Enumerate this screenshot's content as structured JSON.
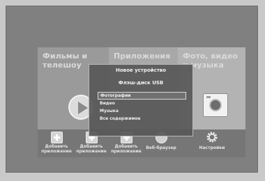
{
  "tiles": [
    {
      "title": "Фильмы и телешоу",
      "icon": "play-icon"
    },
    {
      "title": "Приложения",
      "icon": "apps-icon"
    },
    {
      "title": "Фото, видео и музыка",
      "icon": "camera-icon"
    }
  ],
  "bar": {
    "add1": "Добавить приложение",
    "add2": "Добавить приложение",
    "add3": "Добавить приложение",
    "web": "Веб-браузер",
    "settings": "Настройки"
  },
  "dialog": {
    "title": "Новое устройство",
    "device": "Флэш-диск USB",
    "options": [
      "Фотографии",
      "Видео",
      "Музыка",
      "Все содержимое"
    ],
    "selected": "Фотографии"
  },
  "colors": {
    "accent": "#ffffff",
    "background": "#808080"
  }
}
